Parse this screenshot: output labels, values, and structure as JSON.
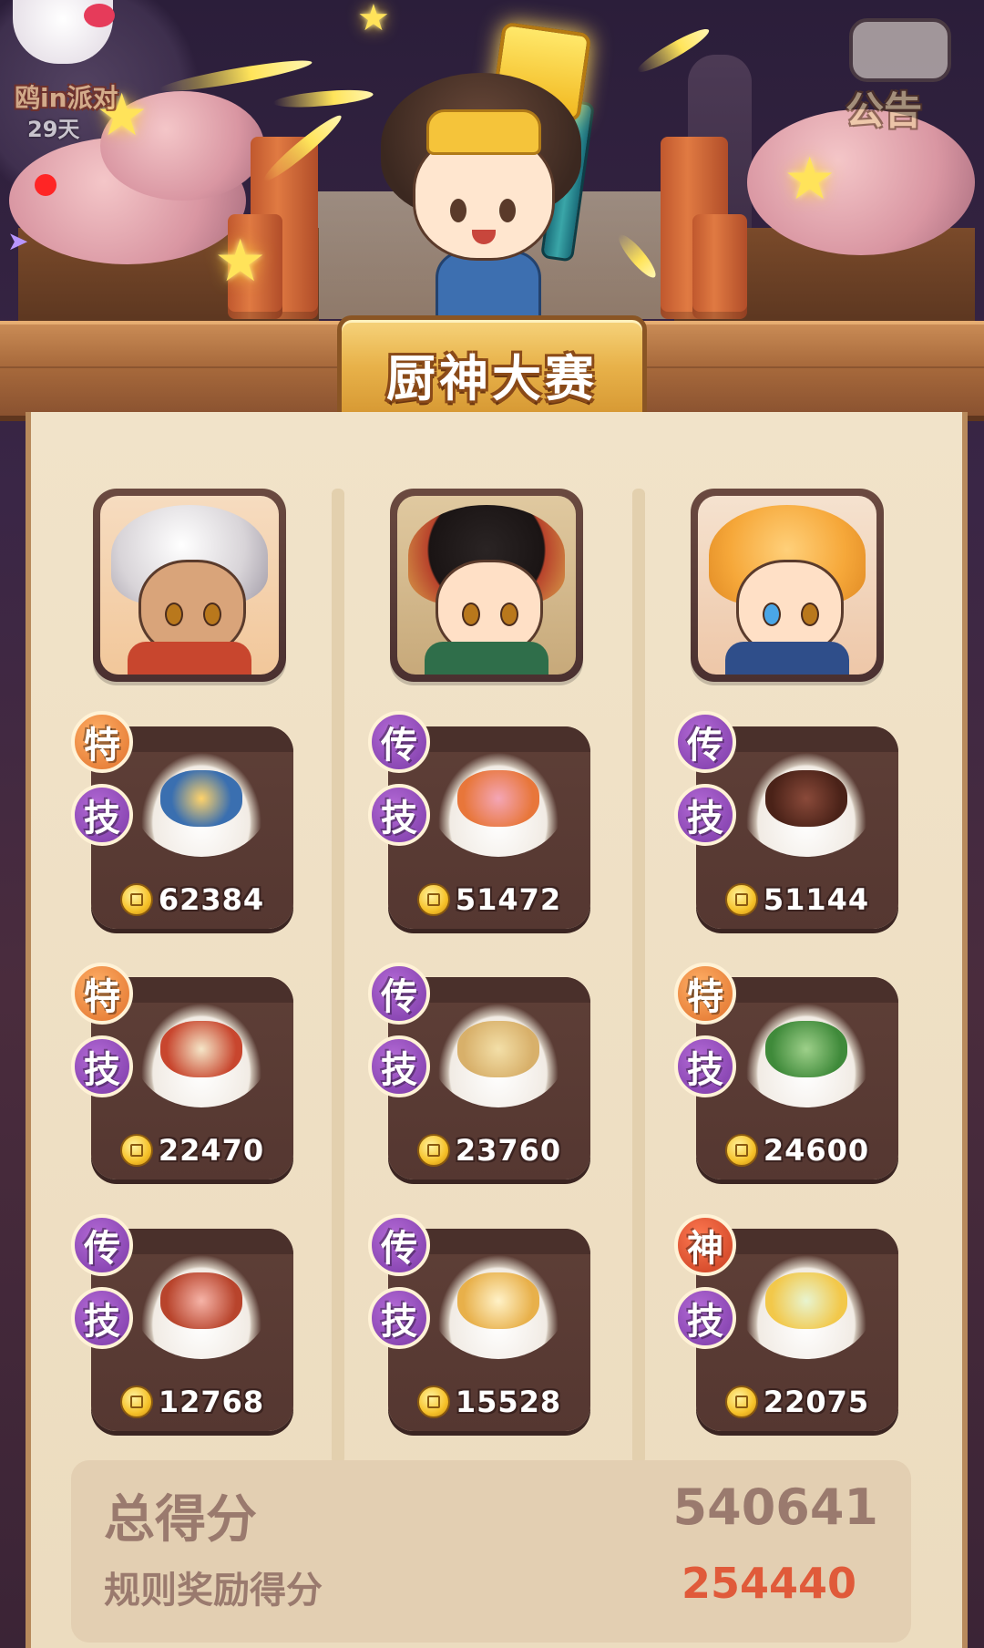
{
  "header": {
    "title": "厨神大赛"
  },
  "event_widget": {
    "label": "鸥in派对",
    "days_left": "29天"
  },
  "notice_button": {
    "label": "公告"
  },
  "columns": [
    {
      "chef_name": "chef-1",
      "dishes": [
        {
          "grade": "特",
          "grade_color": "#e0712b",
          "skill": "技",
          "price": "62384"
        },
        {
          "grade": "特",
          "grade_color": "#e0712b",
          "skill": "技",
          "price": "22470"
        },
        {
          "grade": "传",
          "grade_color": "#7a3aa6",
          "skill": "技",
          "price": "12768"
        }
      ]
    },
    {
      "chef_name": "chef-2",
      "dishes": [
        {
          "grade": "传",
          "grade_color": "#7a3aa6",
          "skill": "技",
          "price": "51472"
        },
        {
          "grade": "传",
          "grade_color": "#7a3aa6",
          "skill": "技",
          "price": "23760"
        },
        {
          "grade": "传",
          "grade_color": "#7a3aa6",
          "skill": "技",
          "price": "15528"
        }
      ]
    },
    {
      "chef_name": "chef-3",
      "dishes": [
        {
          "grade": "传",
          "grade_color": "#7a3aa6",
          "skill": "技",
          "price": "51144"
        },
        {
          "grade": "特",
          "grade_color": "#e0712b",
          "skill": "技",
          "price": "24600"
        },
        {
          "grade": "神",
          "grade_color": "#c83c1f",
          "skill": "技",
          "price": "22075"
        }
      ]
    }
  ],
  "score": {
    "total_label": "总得分",
    "total_value": "540641",
    "bonus_label": "规则奖励得分",
    "bonus_value": "254440"
  },
  "colors": {
    "accent_gold": "#e8b24a",
    "bonus_red": "#e05a3a",
    "panel_bg": "#f1e3c9"
  }
}
